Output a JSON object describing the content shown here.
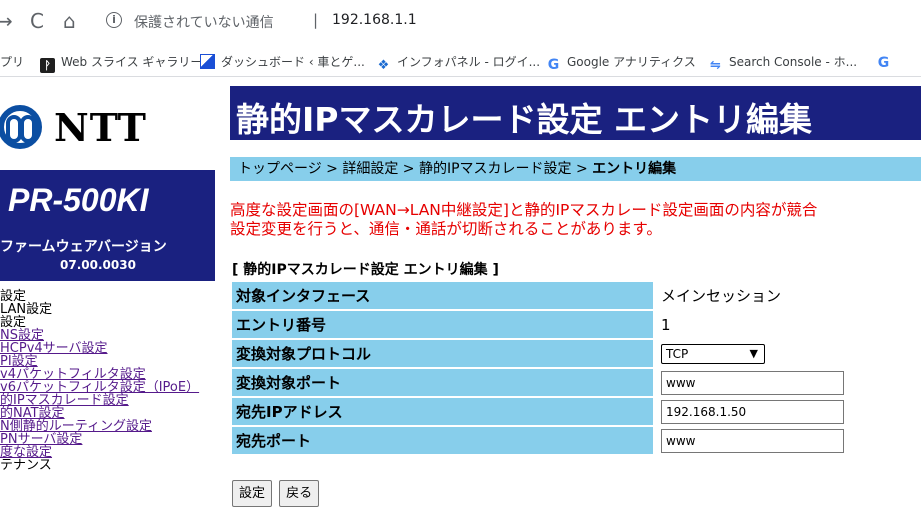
{
  "browser": {
    "security_label": "保護されていない通信",
    "url": "192.168.1.1",
    "bookmarks": [
      {
        "label": "プリ"
      },
      {
        "label": "Web スライス ギャラリー"
      },
      {
        "label": "ダッシュボード ‹ 車とゲ..."
      },
      {
        "label": "インフォパネル - ログイ..."
      },
      {
        "label": "Google アナリティクス"
      },
      {
        "label": "Search Console - ホ..."
      },
      {
        "label": ""
      }
    ]
  },
  "sidebar": {
    "logo_text": "NTT",
    "model": "PR-500KI",
    "firmware_label": "ファームウェアバージョン",
    "firmware_version": "07.00.0030",
    "menu": [
      {
        "label": "設定",
        "link": false
      },
      {
        "label": "LAN設定",
        "link": false
      },
      {
        "label": "設定",
        "link": false
      },
      {
        "label": "NS設定",
        "link": true
      },
      {
        "label": "HCPv4サーバ設定",
        "link": true
      },
      {
        "label": "PI設定",
        "link": true
      },
      {
        "label": "v4パケットフィルタ設定",
        "link": true
      },
      {
        "label": "v6パケットフィルタ設定（IPoE）",
        "link": true
      },
      {
        "label": "的IPマスカレード設定",
        "link": true
      },
      {
        "label": "的NAT設定",
        "link": true
      },
      {
        "label": "N側静的ルーティング設定",
        "link": true
      },
      {
        "label": "PNサーバ設定",
        "link": true
      },
      {
        "label": "度な設定",
        "link": true
      },
      {
        "label": "テナンス",
        "link": false
      }
    ]
  },
  "main": {
    "title": "静的IPマスカレード設定 エントリ編集",
    "breadcrumb": {
      "trail": "トップページ > 詳細設定 > 静的IPマスカレード設定 > ",
      "current": "エントリ編集"
    },
    "warning_lines": [
      "高度な設定画面の[WAN→LAN中継設定]と静的IPマスカレード設定画面の内容が競合",
      "設定変更を行うと、通信・通話が切断されることがあります。"
    ],
    "section_title": "[ 静的IPマスカレード設定 エントリ編集 ]",
    "rows": {
      "interface": {
        "label": "対象インタフェース",
        "value": "メインセッション"
      },
      "entry_no": {
        "label": "エントリ番号",
        "value": "1"
      },
      "protocol": {
        "label": "変換対象プロトコル",
        "value": "TCP"
      },
      "port": {
        "label": "変換対象ポート",
        "value": "www"
      },
      "dest_ip": {
        "label": "宛先IPアドレス",
        "value": "192.168.1.50"
      },
      "dest_port": {
        "label": "宛先ポート",
        "value": "www"
      }
    },
    "buttons": {
      "submit": "設定",
      "back": "戻る"
    }
  }
}
